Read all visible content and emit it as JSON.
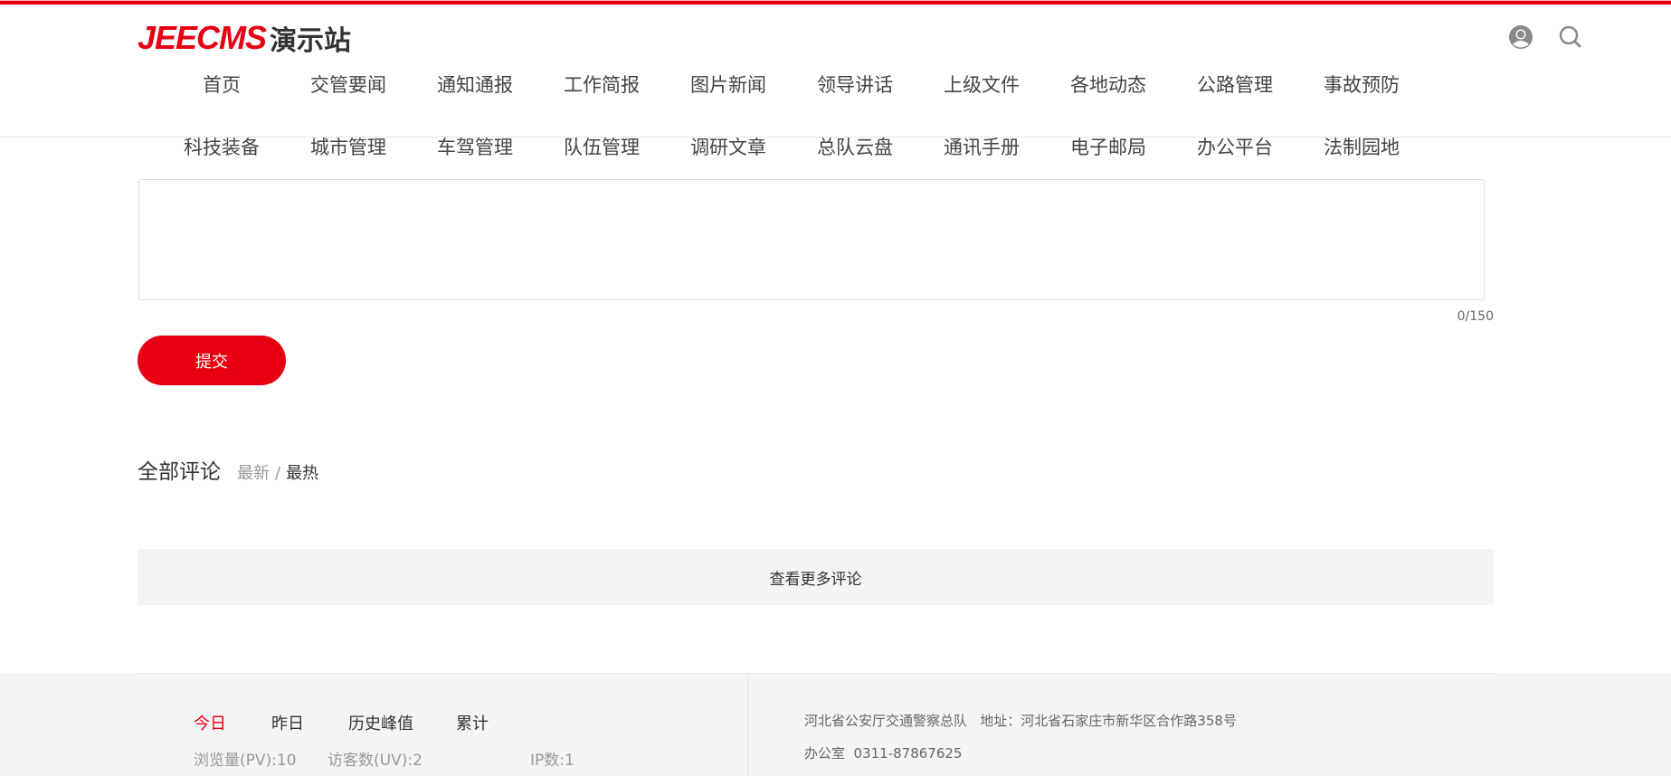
{
  "header": {
    "logo_en": "JEECMS",
    "logo_cn": "演示站",
    "colors": {
      "brand": "#e60012"
    }
  },
  "nav": {
    "row1": [
      "首页",
      "交管要闻",
      "通知通报",
      "工作简报",
      "图片新闻",
      "领导讲话",
      "上级文件",
      "各地动态",
      "公路管理",
      "事故预防"
    ],
    "row2": [
      "科技装备",
      "城市管理",
      "车驾管理",
      "队伍管理",
      "调研文章",
      "总队云盘",
      "通讯手册",
      "电子邮局",
      "办公平台",
      "法制园地"
    ]
  },
  "comment": {
    "value": "",
    "counter": "0/150",
    "submit": "提交",
    "title": "全部评论",
    "sort_new": "最新",
    "sep": "/",
    "sort_hot": "最热",
    "more": "查看更多评论"
  },
  "footer": {
    "tabs": [
      "今日",
      "昨日",
      "历史峰值",
      "累计"
    ],
    "stats": {
      "pv": "浏览量(PV):10",
      "uv": "访客数(UV):2",
      "ip": "IP数:1"
    },
    "address": "河北省公安厅交通警察总队   地址：河北省石家庄市新华区合作路358号",
    "office": "办公室  0311-87867625"
  }
}
